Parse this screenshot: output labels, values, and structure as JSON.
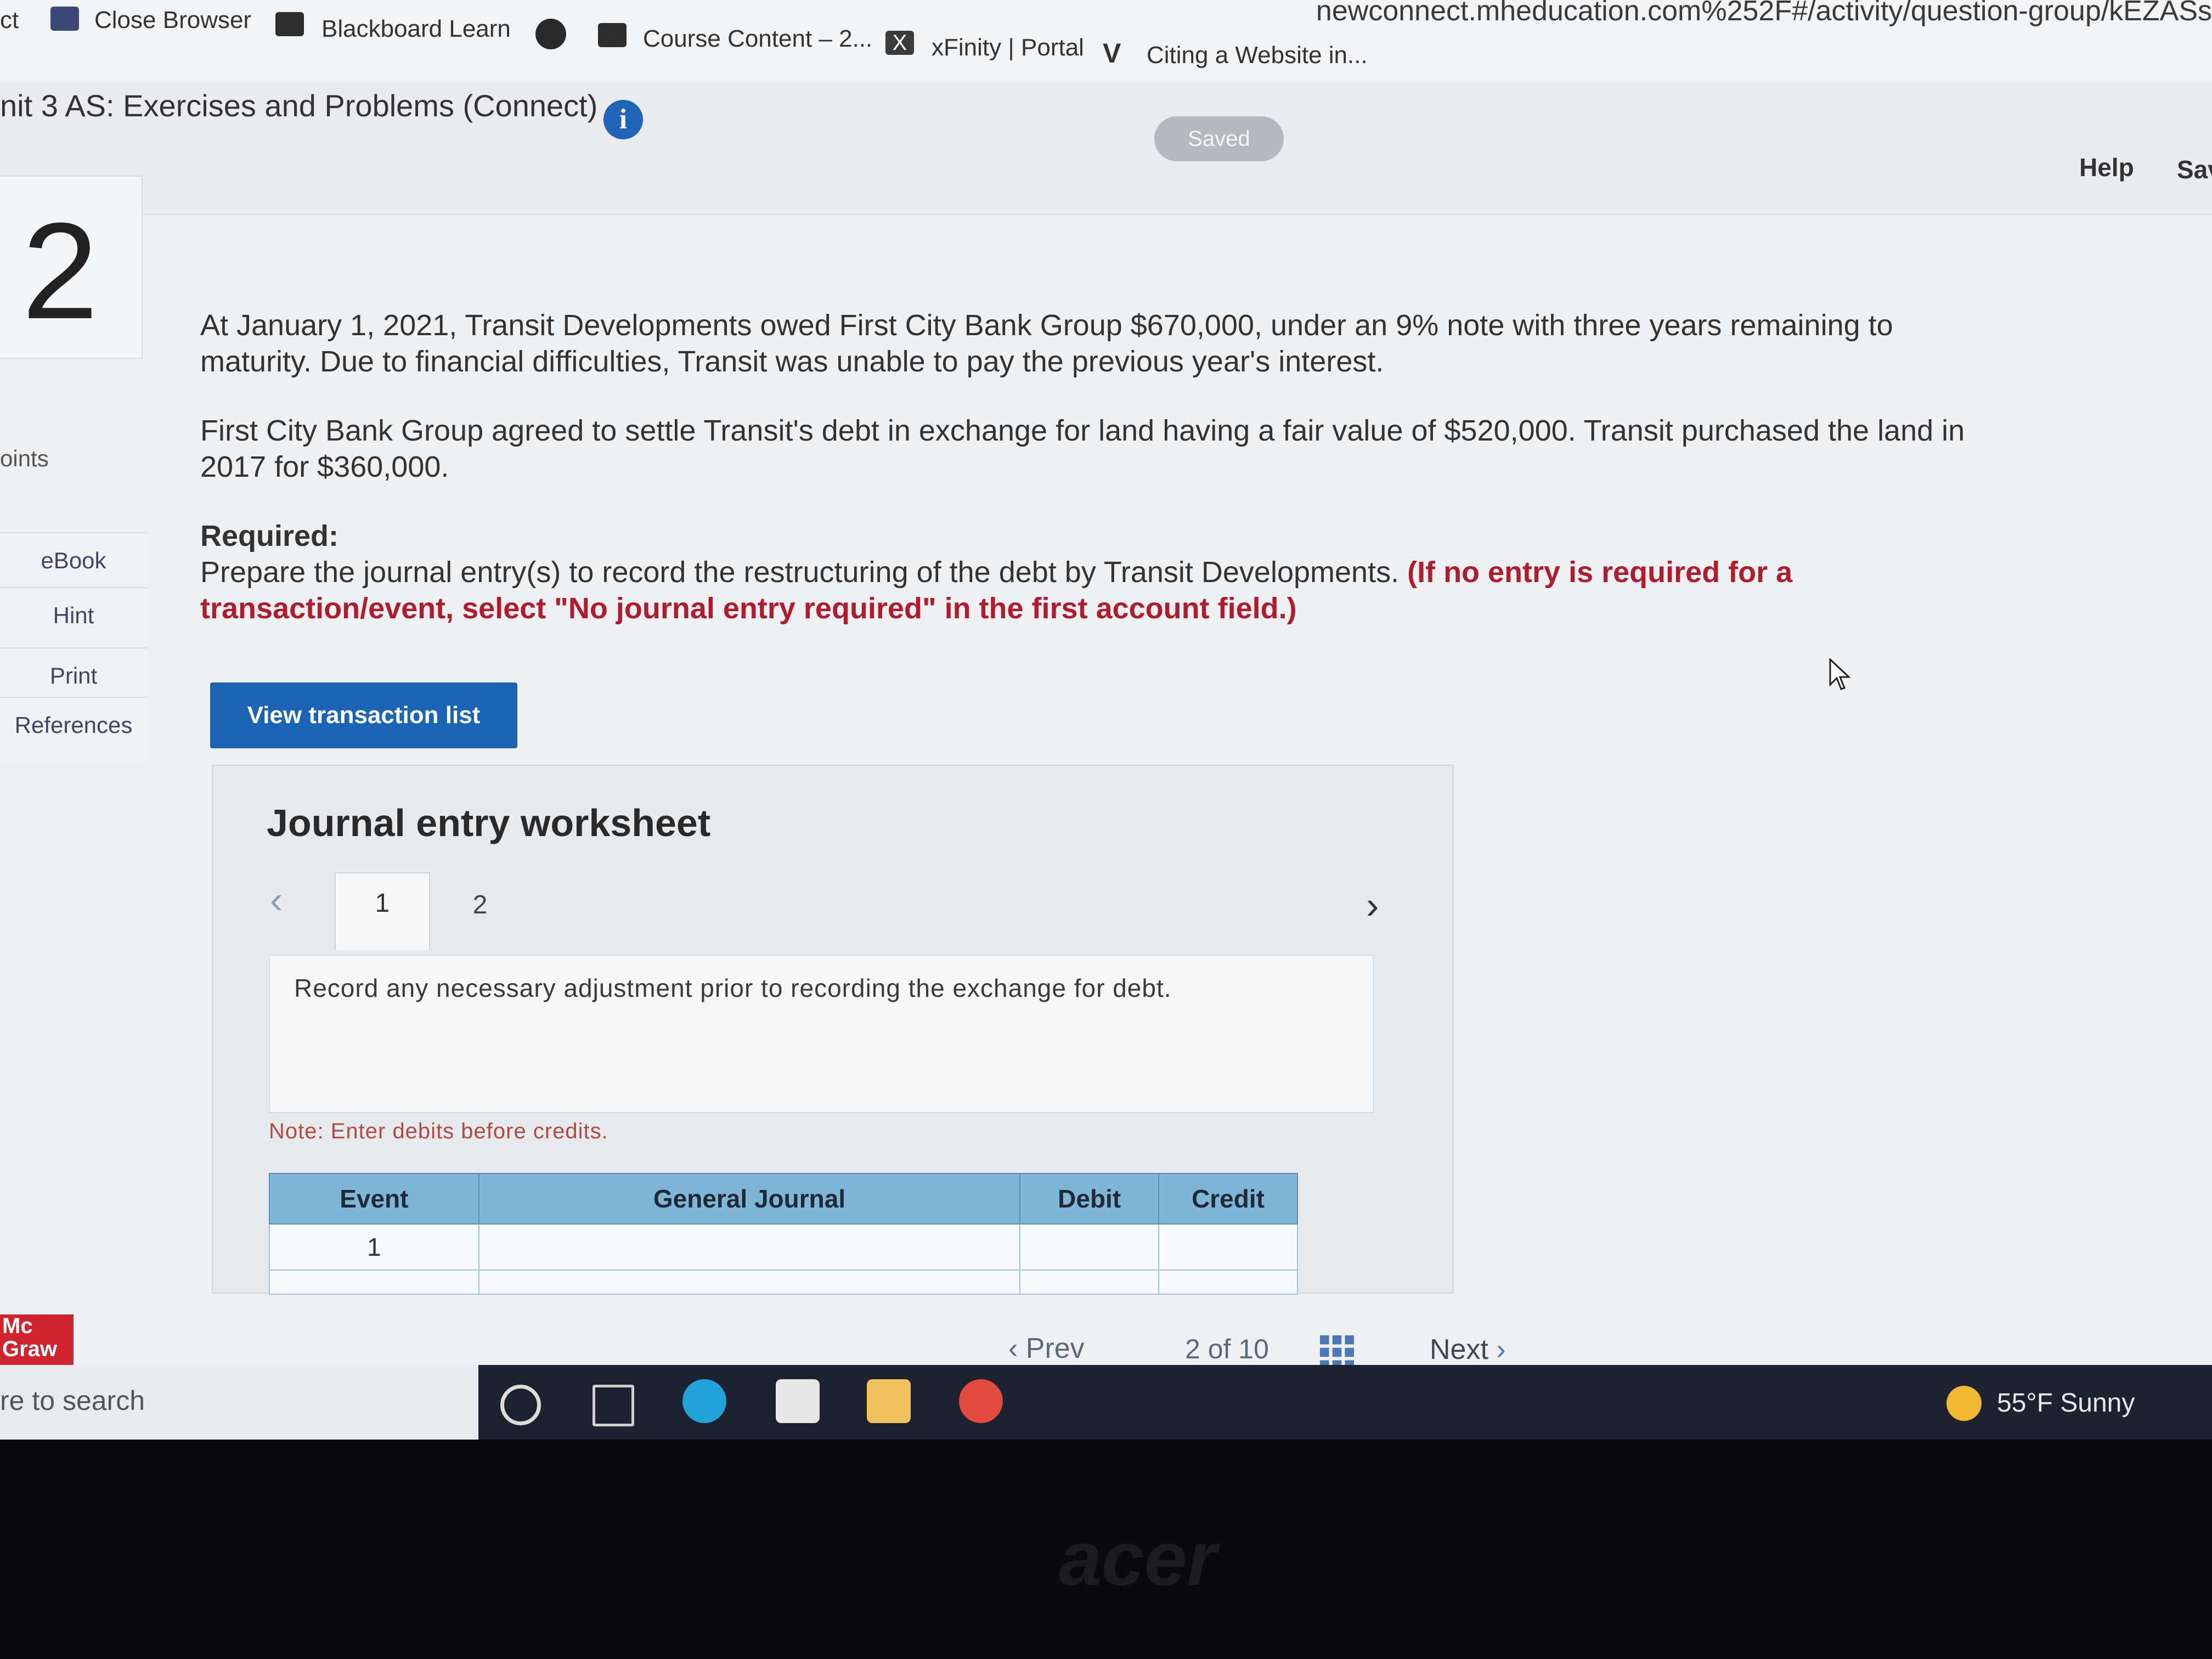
{
  "browser": {
    "url": "newconnect.mheducation.com%252F#/activity/question-group/kEZASs",
    "bookmarks": [
      {
        "label": "ct"
      },
      {
        "label": "Close Browser"
      },
      {
        "label": "Blackboard Learn"
      },
      {
        "label": "Course Content – 2..."
      },
      {
        "label": "xFinity | Portal"
      },
      {
        "label": "Citing a Website in..."
      }
    ]
  },
  "header": {
    "title": "nit 3 AS: Exercises and Problems (Connect)",
    "info_icon": "i",
    "saved_label": "Saved",
    "help_label": "Help",
    "save_exit_label": "Sav"
  },
  "question": {
    "number": "2",
    "points_label": "oints",
    "paragraph1": "At January 1, 2021, Transit Developments owed First City Bank Group $670,000, under an 9% note with three years remaining to maturity. Due to financial difficulties, Transit was unable to pay the previous year's interest.",
    "paragraph2": "First City Bank Group agreed to settle Transit's debt in exchange for land having a fair value of $520,000. Transit purchased the land in 2017 for $360,000.",
    "required_label": "Required:",
    "required_text": "Prepare the journal entry(s) to record the restructuring of the debt by Transit Developments.",
    "required_note": "(If no entry is required for a transaction/event, select \"No journal entry required\" in the first account field.)"
  },
  "rail": {
    "items": [
      "eBook",
      "Hint",
      "Print",
      "References"
    ]
  },
  "actions": {
    "view_transactions": "View transaction list"
  },
  "worksheet": {
    "title": "Journal entry worksheet",
    "tabs": [
      "1",
      "2"
    ],
    "instruction": "Record any necessary adjustment prior to recording the exchange for debt.",
    "note": "Note: Enter debits before credits.",
    "columns": [
      "Event",
      "General Journal",
      "Debit",
      "Credit"
    ],
    "rows": [
      {
        "event": "1",
        "account": "",
        "debit": "",
        "credit": ""
      }
    ]
  },
  "pagination": {
    "prev_label": "Prev",
    "current": "2",
    "of_label": "of 10",
    "next_label": "Next"
  },
  "brand": {
    "mcgraw_line1": "Mc",
    "mcgraw_line2": "Graw"
  },
  "taskbar": {
    "search_placeholder": "re to search",
    "weather": "55°F  Sunny"
  },
  "device": {
    "logo": "acer"
  },
  "colors": {
    "primary_button": "#1a64b4",
    "table_header": "#7fb6d8",
    "instruction_red": "#b01c2e",
    "mcgraw_red": "#d1222e"
  }
}
